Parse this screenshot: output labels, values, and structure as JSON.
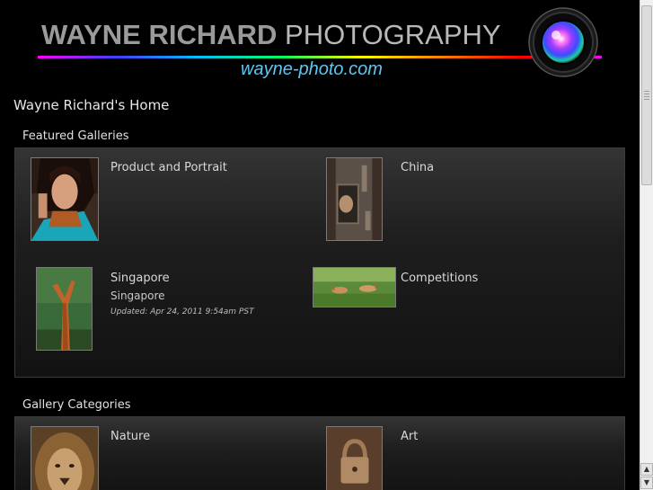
{
  "header": {
    "brand_bold": "WAYNE RICHARD",
    "brand_light": "PHOTOGRAPHY",
    "site_url": "wayne-photo.com"
  },
  "page": {
    "title": "Wayne Richard's Home"
  },
  "featured": {
    "heading": "Featured Galleries",
    "items": [
      {
        "title": "Product and Portrait"
      },
      {
        "title": "China"
      },
      {
        "title": "Singapore",
        "subtitle": "Singapore",
        "updated": "Updated: Apr 24, 2011 9:54am PST"
      },
      {
        "title": "Competitions"
      }
    ]
  },
  "categories": {
    "heading": "Gallery Categories",
    "items": [
      {
        "title": "Nature"
      },
      {
        "title": "Art"
      }
    ]
  },
  "colors": {
    "background": "#000000",
    "url_blue": "#5ec6f2",
    "panel_top": "#343434"
  },
  "icons": {
    "scroll_up": "triangle-up",
    "scroll_down": "triangle-down"
  }
}
